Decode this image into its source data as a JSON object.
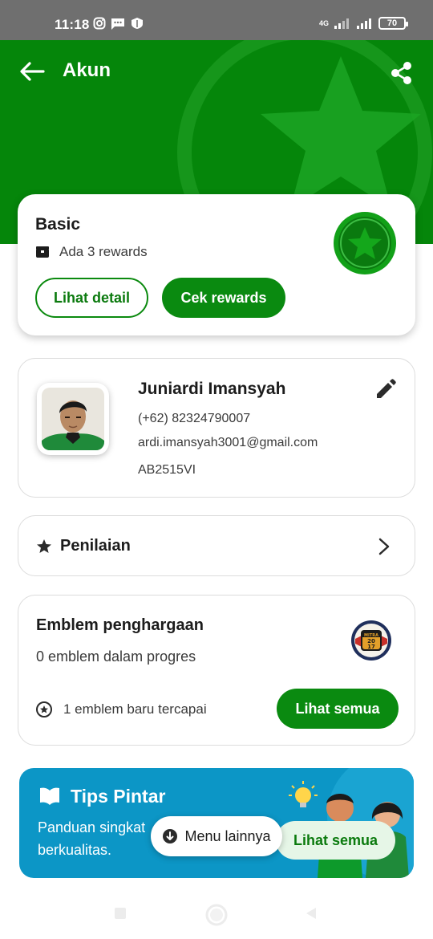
{
  "status_bar": {
    "time": "11:18",
    "network": "4G",
    "battery": "70"
  },
  "header": {
    "title": "Akun"
  },
  "tier": {
    "name": "Basic",
    "rewards_text": "Ada 3 rewards",
    "detail_button": "Lihat detail",
    "rewards_button": "Cek rewards"
  },
  "profile": {
    "name": "Juniardi Imansyah",
    "phone": "(+62) 82324790007",
    "email": "ardi.imansyah3001@gmail.com",
    "driver_id": "AB2515VI"
  },
  "rating": {
    "label": "Penilaian"
  },
  "emblem": {
    "title": "Emblem penghargaan",
    "progress_text": "0 emblem dalam progres",
    "achieved_text": "1 emblem baru tercapai",
    "view_all_button": "Lihat semua",
    "badge_top": "MITRA",
    "badge_num_1": "20",
    "badge_num_2": "17"
  },
  "tips": {
    "title": "Tips Pintar",
    "description": "Panduan singkat berkualitas.",
    "button": "Lihat semua"
  },
  "floating_menu": {
    "label": "Menu lainnya"
  },
  "colors": {
    "brand_green": "#05860a",
    "button_green": "#0a8a10",
    "tips_blue": "#0c96c6"
  }
}
